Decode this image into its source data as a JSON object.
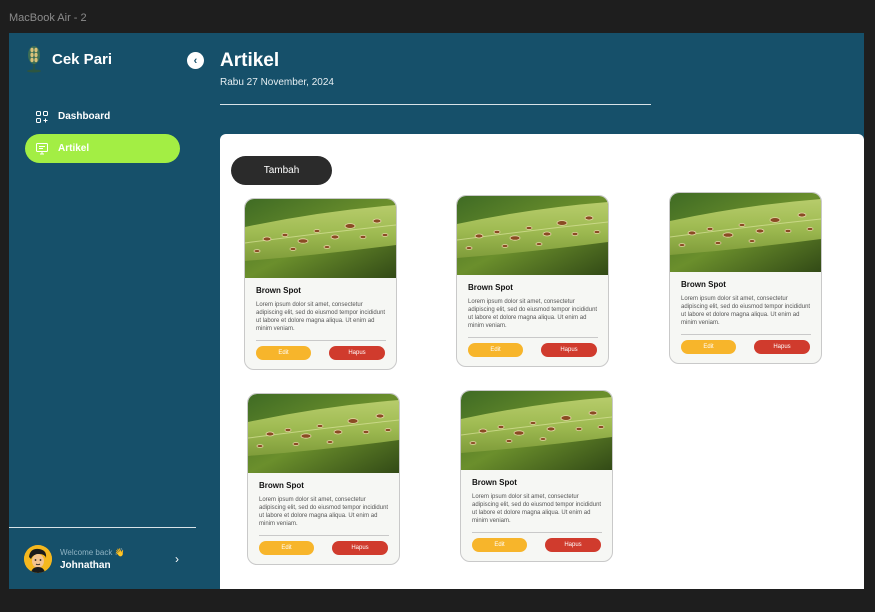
{
  "frame": {
    "label": "MacBook Air - 2"
  },
  "brand": {
    "name": "Cek Pari",
    "logo_icon": "rice-plant-icon"
  },
  "sidebar": {
    "items": [
      {
        "label": "Dashboard",
        "icon": "dashboard-icon",
        "active": false
      },
      {
        "label": "Artikel",
        "icon": "article-icon",
        "active": true
      }
    ],
    "collapse_icon": "chevron-left-icon"
  },
  "user": {
    "welcome": "Welcome back 👋",
    "name": "Johnathan"
  },
  "header": {
    "title": "Artikel",
    "date": "Rabu 27 November, 2024"
  },
  "actions": {
    "add_label": "Tambah"
  },
  "cards": [
    {
      "title": "Brown Spot",
      "description": "Lorem ipsum dolor sit amet, consectetur adipiscing elit, sed do eiusmod tempor incididunt ut labore et dolore magna aliqua. Ut enim ad minim veniam.",
      "edit_label": "Edit",
      "delete_label": "Hapus"
    },
    {
      "title": "Brown Spot",
      "description": "Lorem ipsum dolor sit amet, consectetur adipiscing elit, sed do eiusmod tempor incididunt ut labore et dolore magna aliqua. Ut enim ad minim veniam.",
      "edit_label": "Edit",
      "delete_label": "Hapus"
    },
    {
      "title": "Brown Spot",
      "description": "Lorem ipsum dolor sit amet, consectetur adipiscing elit, sed do eiusmod tempor incididunt ut labore et dolore magna aliqua. Ut enim ad minim veniam.",
      "edit_label": "Edit",
      "delete_label": "Hapus"
    },
    {
      "title": "Brown Spot",
      "description": "Lorem ipsum dolor sit amet, consectetur adipiscing elit, sed do eiusmod tempor incididunt ut labore et dolore magna aliqua. Ut enim ad minim veniam.",
      "edit_label": "Edit",
      "delete_label": "Hapus"
    },
    {
      "title": "Brown Spot",
      "description": "Lorem ipsum dolor sit amet, consectetur adipiscing elit, sed do eiusmod tempor incididunt ut labore et dolore magna aliqua. Ut enim ad minim veniam.",
      "edit_label": "Edit",
      "delete_label": "Hapus"
    }
  ],
  "colors": {
    "app_background": "#16506a",
    "active_nav": "#a3ee44",
    "edit_button": "#f7b52b",
    "delete_button": "#d03b2d",
    "add_button": "#2b2b2b"
  }
}
